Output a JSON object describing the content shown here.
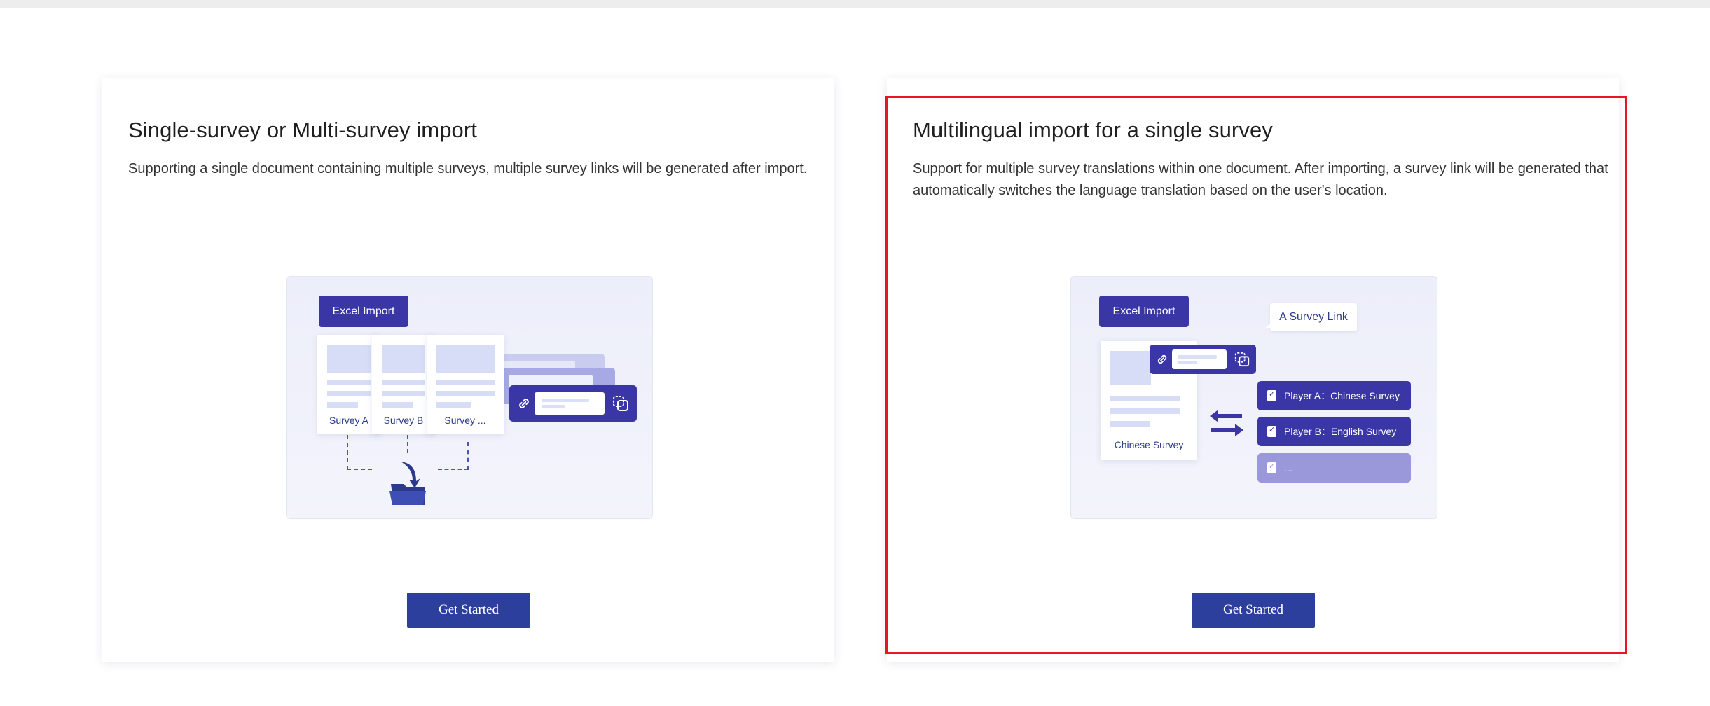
{
  "cards": [
    {
      "title": "Single-survey or Multi-survey import",
      "description": "Supporting a single document containing multiple surveys, multiple survey links will be generated after import.",
      "button_label": "Get Started",
      "illustration": {
        "tag": "Excel Import",
        "docs": [
          "Survey A",
          "Survey B",
          "Survey ..."
        ]
      }
    },
    {
      "title": "Multilingual import for a single survey",
      "description": "Support for multiple survey translations within one document. After importing, a survey link will be generated that automatically switches the language translation based on the user's location.",
      "button_label": "Get Started",
      "selected": true,
      "illustration": {
        "tag": "Excel Import",
        "bubble": "A Survey Link",
        "doc_caption": "Chinese Survey",
        "players": [
          "Player A：Chinese Survey",
          "Player B：English Survey",
          "..."
        ]
      }
    }
  ],
  "colors": {
    "brand": "#2d3f9c",
    "illustration_primary": "#3a36a6",
    "illustration_faded": "#9a98db",
    "selection_border": "#e8171f"
  }
}
